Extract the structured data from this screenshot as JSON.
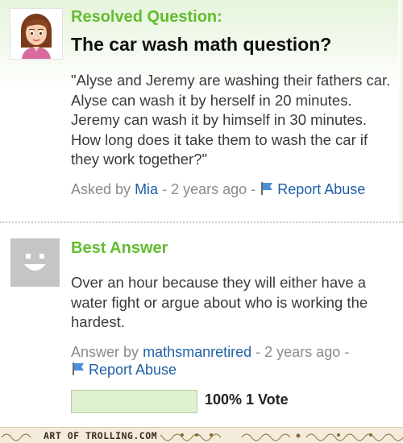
{
  "question": {
    "status_label": "Resolved Question:",
    "title": "The car wash math question?",
    "body": "\"Alyse and Jeremy are washing their fathers car. Alyse can wash it by herself in 20 minutes. Jeremy can wash it by himself in 30 minutes. How long does it take them to wash the car if they work together?\"",
    "asked_by_prefix": "Asked by",
    "asker_name": "Mia",
    "separator": "-",
    "time_ago": "2 years ago",
    "report_label": "Report Abuse"
  },
  "best_answer": {
    "label": "Best Answer",
    "body": "Over an hour because they will either have a water fight or argue about who is working the hardest.",
    "answer_by_prefix": "Answer by",
    "answerer_name": "mathsmanretired",
    "separator": "-",
    "time_ago": "2 years ago",
    "report_label": "Report Abuse",
    "vote_percent": "100%",
    "vote_count": "1 Vote",
    "vote_fraction": 1.0
  },
  "watermark": {
    "text": "ART OF TROLLING.COM"
  },
  "colors": {
    "accent_green": "#62bd2f",
    "link_blue": "#1f5fa6",
    "flag_blue": "#4a90d9",
    "vote_fill": "#dff0cf"
  },
  "icons": {
    "asker_avatar": "cartoon-girl-avatar",
    "answerer_avatar": "smiley-placeholder-avatar",
    "report_flag": "flag-icon"
  }
}
